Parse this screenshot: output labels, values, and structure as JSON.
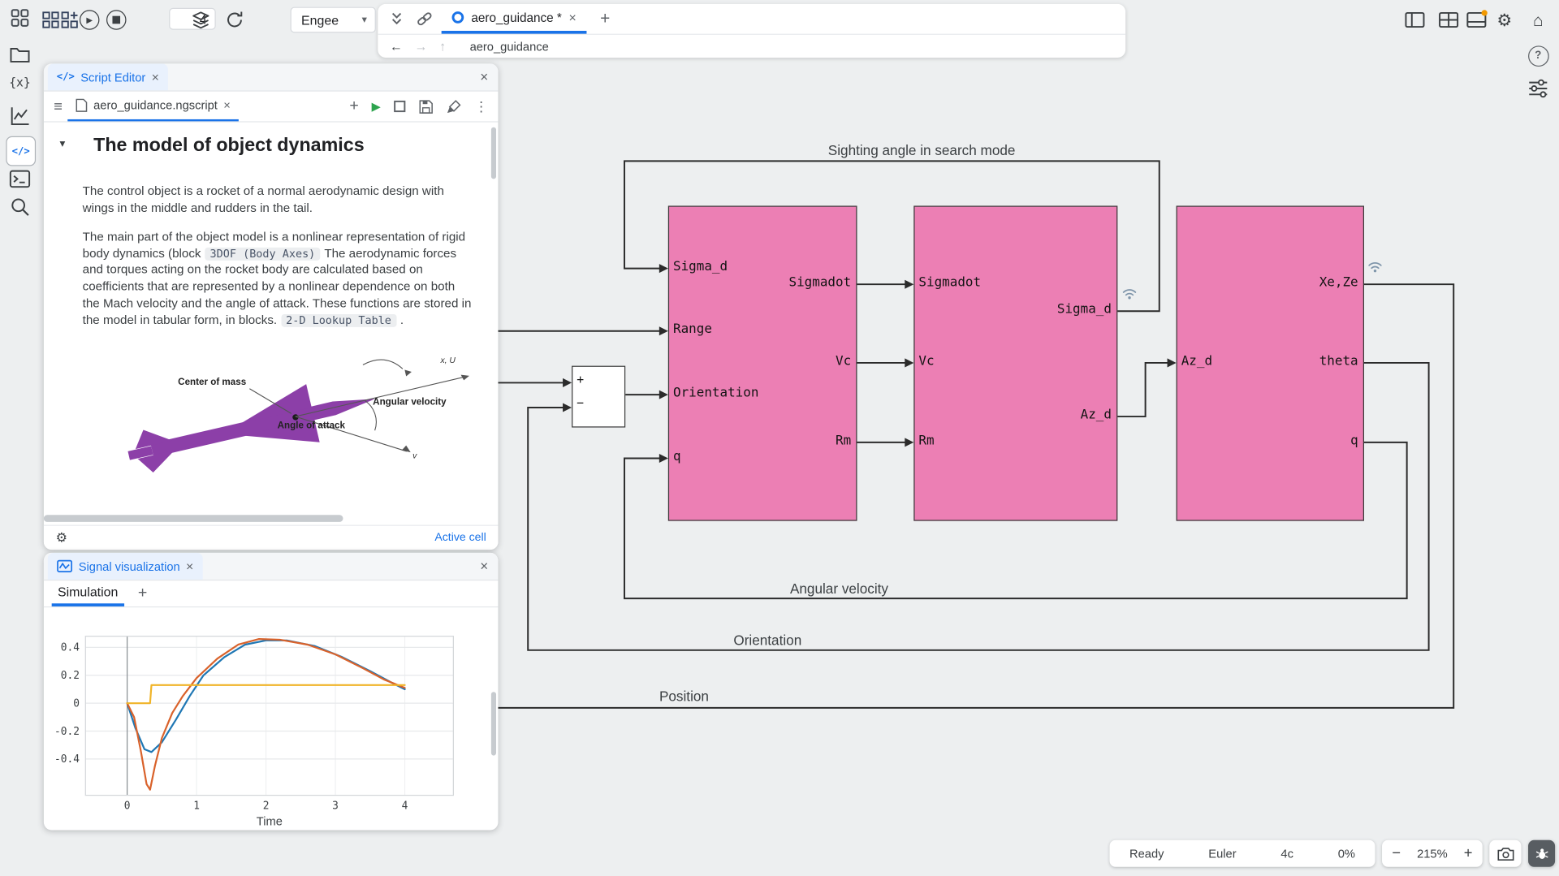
{
  "app": {
    "background": "#edeff0",
    "accent": "#1a73e8",
    "block_color": "#ec7fb4"
  },
  "icons": {
    "caret_down": "▾",
    "gear": "⚙",
    "home": "⌂",
    "help": "?",
    "close": "×",
    "plus": "+",
    "minus": "−",
    "back": "←",
    "forward": "→",
    "up": "↑",
    "kebab": "⋮",
    "list": "≡",
    "play": "▶",
    "code": "</>",
    "fx": "{x}"
  },
  "toolbar": {
    "iterations": "4",
    "target": "Engee"
  },
  "tab_bar": {
    "active_tab": "aero_guidance *"
  },
  "breadcrumb": {
    "path": "aero_guidance"
  },
  "script_editor": {
    "title": "Script Editor",
    "file_tab": "aero_guidance.ngscript",
    "heading": "The model of object dynamics",
    "paragraph_1": "The control object is a rocket of a normal aerodynamic design with wings in the middle and rudders in the tail.",
    "paragraph_2_start": "The main part of the object model is a nonlinear representation of rigid body dynamics (block",
    "code_chip_1": "3DOF (Body Axes)",
    "paragraph_2_middle": "The aerodynamic forces and torques acting on the rocket body are calculated based on coefficients that are represented by a nonlinear dependence on both the Mach velocity and the angle of attack. These functions are stored in the model in tabular form, in blocks.",
    "code_chip_2": "2-D Lookup Table",
    "paragraph_2_end": ".",
    "figure": {
      "center_of_mass": "Center of mass",
      "angular_velocity": "Angular velocity",
      "angle_of_attack": "Angle of attack",
      "axis": "x, U",
      "velocity": "v"
    },
    "active_cell": "Active cell"
  },
  "signal_panel": {
    "title": "Signal visualization",
    "tab": "Simulation"
  },
  "chart_data": {
    "type": "line",
    "title": "",
    "xlabel": "Time",
    "ylabel": "",
    "xlim": [
      -0.6,
      4.7
    ],
    "ylim": [
      -0.66,
      0.48
    ],
    "x_ticks": [
      0,
      1,
      2,
      3,
      4
    ],
    "y_ticks": [
      0.4,
      0.2,
      0,
      -0.2,
      -0.4
    ],
    "grid": true,
    "legend": false,
    "series": [
      {
        "name": "blue",
        "color": "#1f77b4",
        "points": [
          [
            0,
            0
          ],
          [
            0.12,
            -0.18
          ],
          [
            0.25,
            -0.33
          ],
          [
            0.35,
            -0.35
          ],
          [
            0.5,
            -0.28
          ],
          [
            0.7,
            -0.12
          ],
          [
            0.9,
            0.05
          ],
          [
            1.1,
            0.2
          ],
          [
            1.4,
            0.33
          ],
          [
            1.7,
            0.42
          ],
          [
            2.0,
            0.45
          ],
          [
            2.3,
            0.45
          ],
          [
            2.7,
            0.41
          ],
          [
            3.1,
            0.33
          ],
          [
            3.5,
            0.23
          ],
          [
            3.8,
            0.15
          ],
          [
            4.0,
            0.1
          ]
        ]
      },
      {
        "name": "orange",
        "color": "#d9622b",
        "points": [
          [
            0,
            0
          ],
          [
            0.1,
            -0.1
          ],
          [
            0.2,
            -0.35
          ],
          [
            0.28,
            -0.58
          ],
          [
            0.33,
            -0.62
          ],
          [
            0.4,
            -0.45
          ],
          [
            0.5,
            -0.25
          ],
          [
            0.65,
            -0.07
          ],
          [
            0.8,
            0.05
          ],
          [
            1.0,
            0.18
          ],
          [
            1.3,
            0.32
          ],
          [
            1.6,
            0.42
          ],
          [
            1.9,
            0.46
          ],
          [
            2.2,
            0.455
          ],
          [
            2.6,
            0.42
          ],
          [
            3.0,
            0.35
          ],
          [
            3.4,
            0.25
          ],
          [
            3.7,
            0.17
          ],
          [
            4.0,
            0.11
          ]
        ]
      },
      {
        "name": "yellow",
        "color": "#f0b429",
        "points": [
          [
            0,
            0
          ],
          [
            0.33,
            0
          ],
          [
            0.35,
            0.13
          ],
          [
            4.0,
            0.13
          ]
        ]
      }
    ]
  },
  "diagram": {
    "wire_labels": [
      "Sighting angle in search mode",
      "Angular velocity",
      "Orientation",
      "Position"
    ],
    "blocks": [
      {
        "inputs": [
          "Sigma_d",
          "Range",
          "Orientation",
          "q"
        ],
        "outputs": [
          "Sigmadot",
          "Vc",
          "Rm"
        ]
      },
      {
        "inputs": [
          "Sigmadot",
          "Vc",
          "Rm"
        ],
        "outputs": [
          "Sigma_d",
          "Az_d"
        ]
      },
      {
        "inputs": [
          "Az_d"
        ],
        "outputs": [
          "Xe,Ze",
          "theta",
          "q"
        ]
      }
    ],
    "sum": {
      "plus": "+",
      "minus": "−"
    }
  },
  "status_bar": {
    "status": "Ready",
    "solver": "Euler",
    "step": "4c",
    "progress": "0%",
    "zoom": "215%"
  }
}
